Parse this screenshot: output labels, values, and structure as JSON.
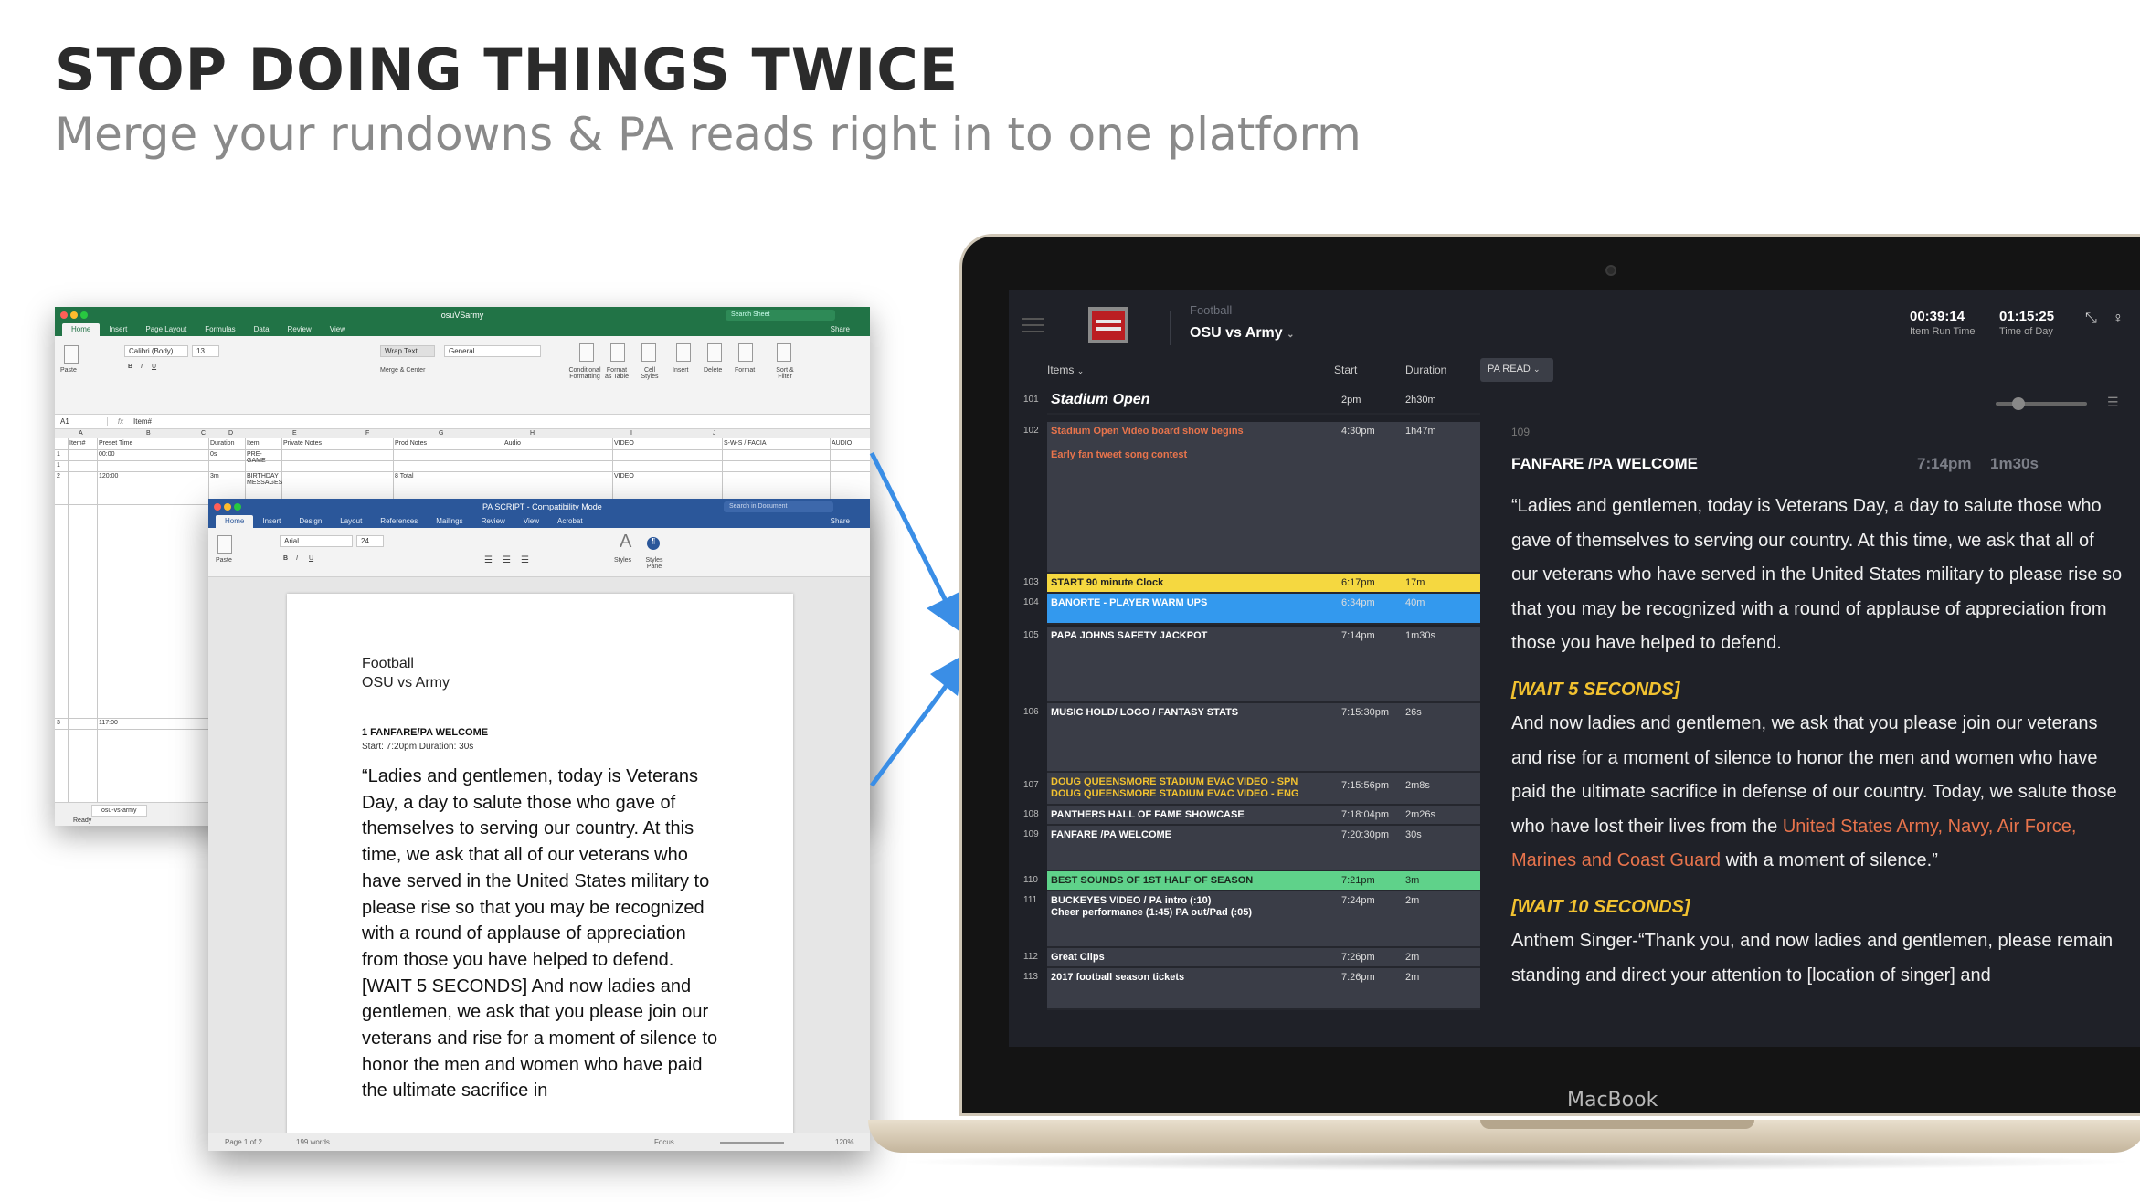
{
  "headline": "STOP DOING THINGS TWICE",
  "subheadline": "Merge your rundowns & PA reads right in to one platform",
  "excel": {
    "filename": "osuVSarmy",
    "search_placeholder": "Search Sheet",
    "tabs": [
      "Home",
      "Insert",
      "Page Layout",
      "Formulas",
      "Data",
      "Review",
      "View"
    ],
    "share": "Share",
    "font_name": "Calibri (Body)",
    "font_size": "13",
    "wrap_text": "Wrap Text",
    "merge_center": "Merge & Center",
    "number_format": "General",
    "paste": "Paste",
    "ribbon_groups": [
      "Conditional Formatting",
      "Format as Table",
      "Cell Styles",
      "Insert",
      "Delete",
      "Format",
      "Sort & Filter"
    ],
    "cell_ref": "A1",
    "formula": "Item#",
    "columns": [
      "A",
      "B",
      "C",
      "D",
      "E",
      "F",
      "G",
      "H",
      "I",
      "J"
    ],
    "headers": [
      "Item#",
      "Preset Time",
      "Duration",
      "Item",
      "Private Notes",
      "Prod Notes",
      "Audio",
      "VIDEO",
      "S-W-S / FACIA",
      "AUDIO"
    ],
    "rows": [
      {
        "rownum": "1",
        "item": "",
        "time": "00:00",
        "dur": "0s",
        "name": "PRE-GAME",
        "prod": "",
        "video": ""
      },
      {
        "rownum": "2",
        "item": "",
        "time": "120:00",
        "dur": "3m",
        "name": "BIRTHDAY MESSAGES",
        "prod": "8 Total",
        "video": "VIDEO"
      },
      {
        "rownum": "3",
        "item": "",
        "time": "117:00",
        "dur": "",
        "name": "",
        "prod": "",
        "video": ""
      }
    ],
    "sheet_tab": "osu-vs-army",
    "status": "Ready"
  },
  "word": {
    "filename": "PA SCRIPT - Compatibility Mode",
    "search_placeholder": "Search in Document",
    "tabs": [
      "Home",
      "Insert",
      "Design",
      "Layout",
      "References",
      "Mailings",
      "Review",
      "View",
      "Acrobat"
    ],
    "share": "Share",
    "font_name": "Arial",
    "font_size": "24",
    "paste": "Paste",
    "styles": "Styles",
    "styles_pane": "Styles Pane",
    "doc": {
      "line1": "Football",
      "line2": "OSU vs Army",
      "item_title": "1 FANFARE/PA WELCOME",
      "item_meta": "Start: 7:20pm    Duration: 30s",
      "body": "“Ladies and gentlemen, today is Veterans Day, a day to salute those who gave of themselves to serving our country.  At this time, we ask that all of our veterans who have served in the United States military to please rise so that you may be recognized with a round of applause of appreciation from those you have helped to defend. [WAIT 5 SECONDS] And now ladies and gentlemen, we ask that you please join our veterans and rise for a moment of silence to honor the men and women who have paid the ultimate sacrifice in"
    },
    "status": {
      "page": "Page 1 of 2",
      "words": "199 words",
      "focus": "Focus",
      "zoom": "120%"
    }
  },
  "macbook_label": "MacBook",
  "app": {
    "sub": "Football",
    "title": "OSU vs Army",
    "item_run_time": "00:39:14",
    "item_run_time_label": "Item Run Time",
    "time_of_day": "01:15:25",
    "time_of_day_label": "Time of Day",
    "col_items": "Items",
    "col_start": "Start",
    "col_duration": "Duration",
    "pa_read_button": "PA READ",
    "rows": [
      {
        "num": "101",
        "name": "Stadium Open",
        "start": "2pm",
        "dur": "2h30m"
      },
      {
        "num": "102",
        "name": "Stadium Open Video board show begins",
        "name2": "Early fan tweet song contest",
        "start": "4:30pm",
        "dur": "1h47m"
      },
      {
        "num": "103",
        "name": "START 90 minute Clock",
        "start": "6:17pm",
        "dur": "17m"
      },
      {
        "num": "104",
        "name": "BANORTE - PLAYER WARM UPS",
        "start": "6:34pm",
        "dur": "40m"
      },
      {
        "num": "105",
        "name": "PAPA JOHNS SAFETY JACKPOT",
        "start": "7:14pm",
        "dur": "1m30s"
      },
      {
        "num": "106",
        "name": "MUSIC HOLD/ LOGO / FANTASY STATS",
        "start": "7:15:30pm",
        "dur": "26s"
      },
      {
        "num": "107",
        "name": "DOUG QUEENSMORE STADIUM EVAC VIDEO - SPN",
        "name2": "DOUG QUEENSMORE STADIUM EVAC VIDEO - ENG",
        "start": "7:15:56pm",
        "dur": "2m8s"
      },
      {
        "num": "108",
        "name": "PANTHERS HALL OF FAME SHOWCASE",
        "start": "7:18:04pm",
        "dur": "2m26s"
      },
      {
        "num": "109",
        "name": "FANFARE /PA WELCOME",
        "start": "7:20:30pm",
        "dur": "30s"
      },
      {
        "num": "110",
        "name": "BEST SOUNDS OF 1ST HALF OF SEASON",
        "start": "7:21pm",
        "dur": "3m"
      },
      {
        "num": "111",
        "name": "BUCKEYES VIDEO / PA intro (:10)",
        "name2": "Cheer performance (1:45) PA out/Pad (:05)",
        "start": "7:24pm",
        "dur": "2m"
      },
      {
        "num": "112",
        "name": "Great Clips",
        "start": "7:26pm",
        "dur": "2m"
      },
      {
        "num": "113",
        "name": "2017 football season tickets",
        "start": "7:26pm",
        "dur": "2m"
      }
    ],
    "pa": {
      "item_num": "109",
      "item_title": "FANFARE /PA WELCOME",
      "item_time": "7:14pm",
      "item_dur": "1m30s",
      "p1": "“Ladies and gentlemen, today is Veterans Day, a day to salute those who gave of themselves to serving our country.  At this time, we ask that all of our veterans who have served in the United States military to please rise so that you may be recognized with a round of applause of appreciation from those you have helped to defend.",
      "cue1": "[WAIT 5 SECONDS]",
      "p2a": "And now ladies and gentlemen, we ask that you please join our veterans and rise for a moment of silence to honor the men and women who have paid the ultimate sacrifice in defense of our country.  Today, we salute those who have lost their lives from the",
      "p2hl": "United States Army, Navy, Air Force, Marines and Coast Guard",
      "p2b": " with a moment of silence.”",
      "cue2": "[WAIT 10 SECONDS]",
      "p3": "Anthem Singer-“Thank you, and now ladies and gentlemen, please remain standing and direct your attention to [location of singer] and"
    }
  }
}
